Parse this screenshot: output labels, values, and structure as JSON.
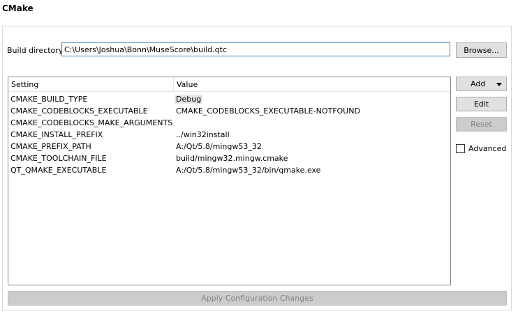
{
  "section": {
    "title": "CMake"
  },
  "build": {
    "label": "Build directory:",
    "value": "C:\\Users\\Joshua\\Bonn\\MuseScore\\build.qtc",
    "browse_label": "Browse..."
  },
  "table": {
    "headers": {
      "setting": "Setting",
      "value": "Value"
    },
    "rows": [
      {
        "key": "CMAKE_BUILD_TYPE",
        "value": "Debug"
      },
      {
        "key": "CMAKE_CODEBLOCKS_EXECUTABLE",
        "value": "CMAKE_CODEBLOCKS_EXECUTABLE-NOTFOUND"
      },
      {
        "key": "CMAKE_CODEBLOCKS_MAKE_ARGUMENTS",
        "value": ""
      },
      {
        "key": "CMAKE_INSTALL_PREFIX",
        "value": "../win32install"
      },
      {
        "key": "CMAKE_PREFIX_PATH",
        "value": "A:/Qt/5.8/mingw53_32"
      },
      {
        "key": "CMAKE_TOOLCHAIN_FILE",
        "value": "build/mingw32.mingw.cmake"
      },
      {
        "key": "QT_QMAKE_EXECUTABLE",
        "value": "A:/Qt/5.8/mingw53_32/bin/qmake.exe"
      }
    ]
  },
  "side": {
    "add_label": "Add",
    "edit_label": "Edit",
    "reset_label": "Reset",
    "advanced_label": "Advanced"
  },
  "footer": {
    "apply_label": "Apply Configuration Changes"
  }
}
